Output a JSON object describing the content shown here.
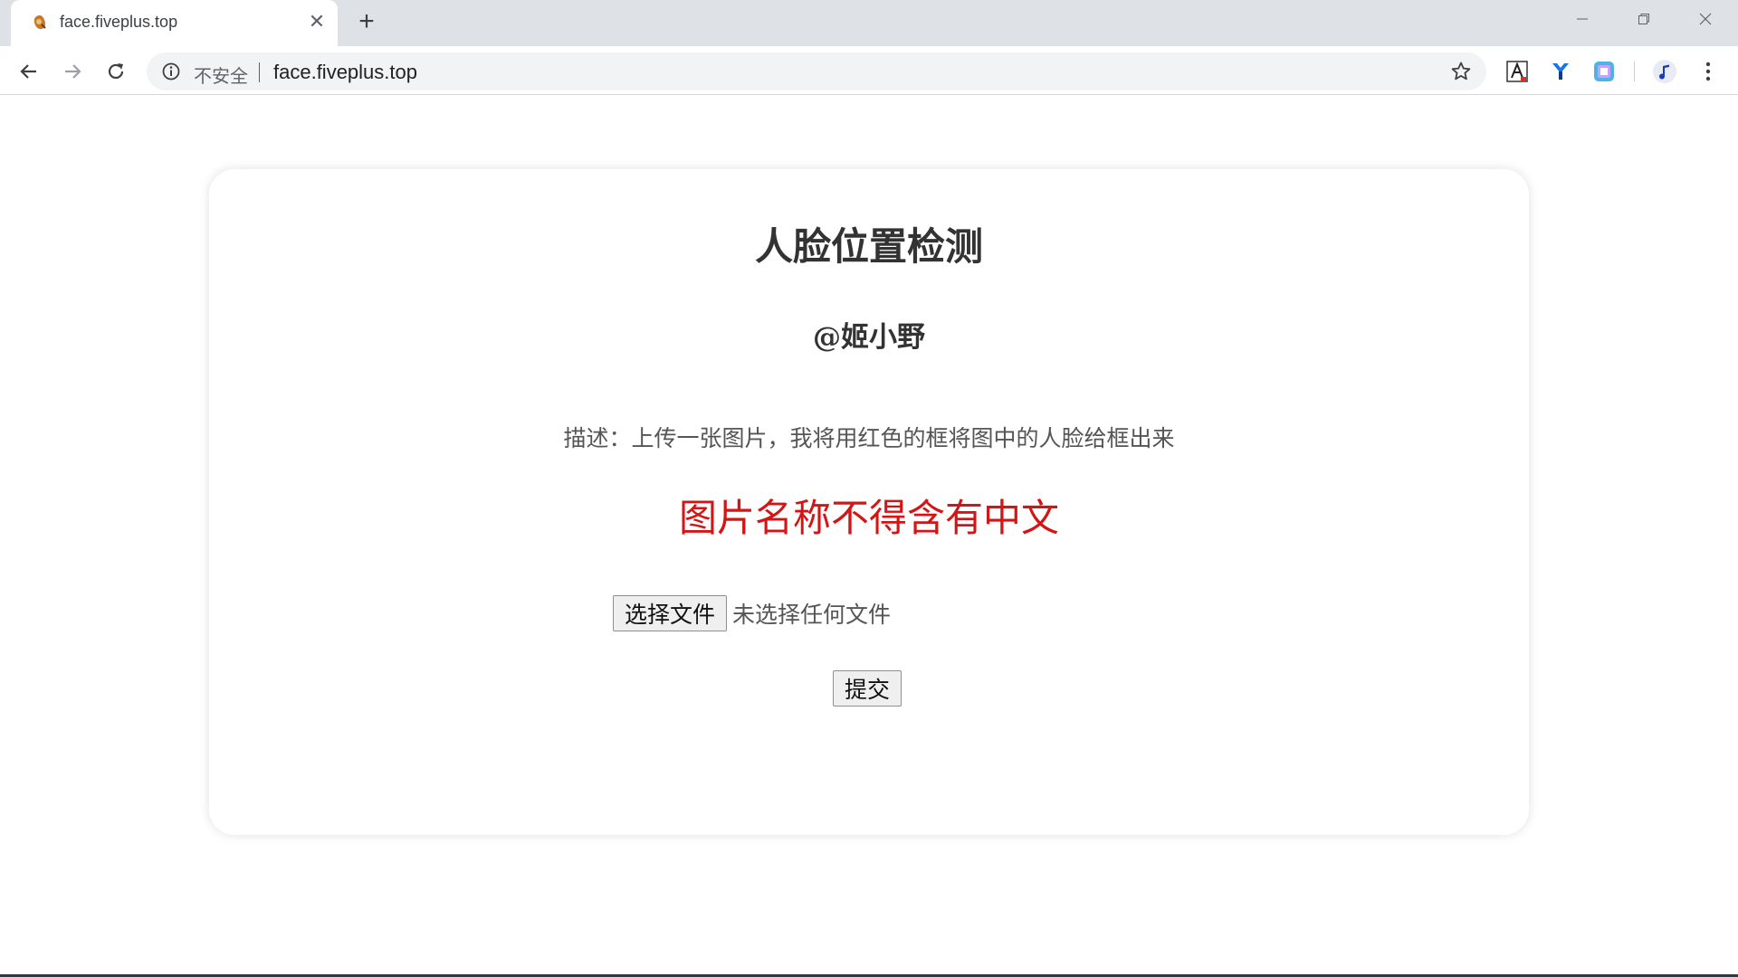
{
  "browser": {
    "tab": {
      "title": "face.fiveplus.top",
      "close_glyph": "✕"
    },
    "new_tab_glyph": "+",
    "address_bar": {
      "security_label": "不安全",
      "url": "face.fiveplus.top"
    }
  },
  "page": {
    "title": "人脸位置检测",
    "author": "@姬小野",
    "description": "描述：上传一张图片，我将用红色的框将图中的人脸给框出来",
    "warning": "图片名称不得含有中文",
    "warning_color": "#d41515",
    "file_input": {
      "button_label": "选择文件",
      "status": "未选择任何文件"
    },
    "submit_label": "提交"
  },
  "icons": {
    "favicon": "fiveplus-favicon-icon",
    "back": "arrow-left-icon",
    "forward": "arrow-right-icon",
    "reload": "reload-icon",
    "info": "info-icon",
    "bookmark": "star-icon",
    "extensions": [
      "font-a-extension-icon",
      "y-extension-icon",
      "translate-extension-icon"
    ],
    "profile": "music-note-profile-icon",
    "menu": "kebab-menu-icon"
  }
}
